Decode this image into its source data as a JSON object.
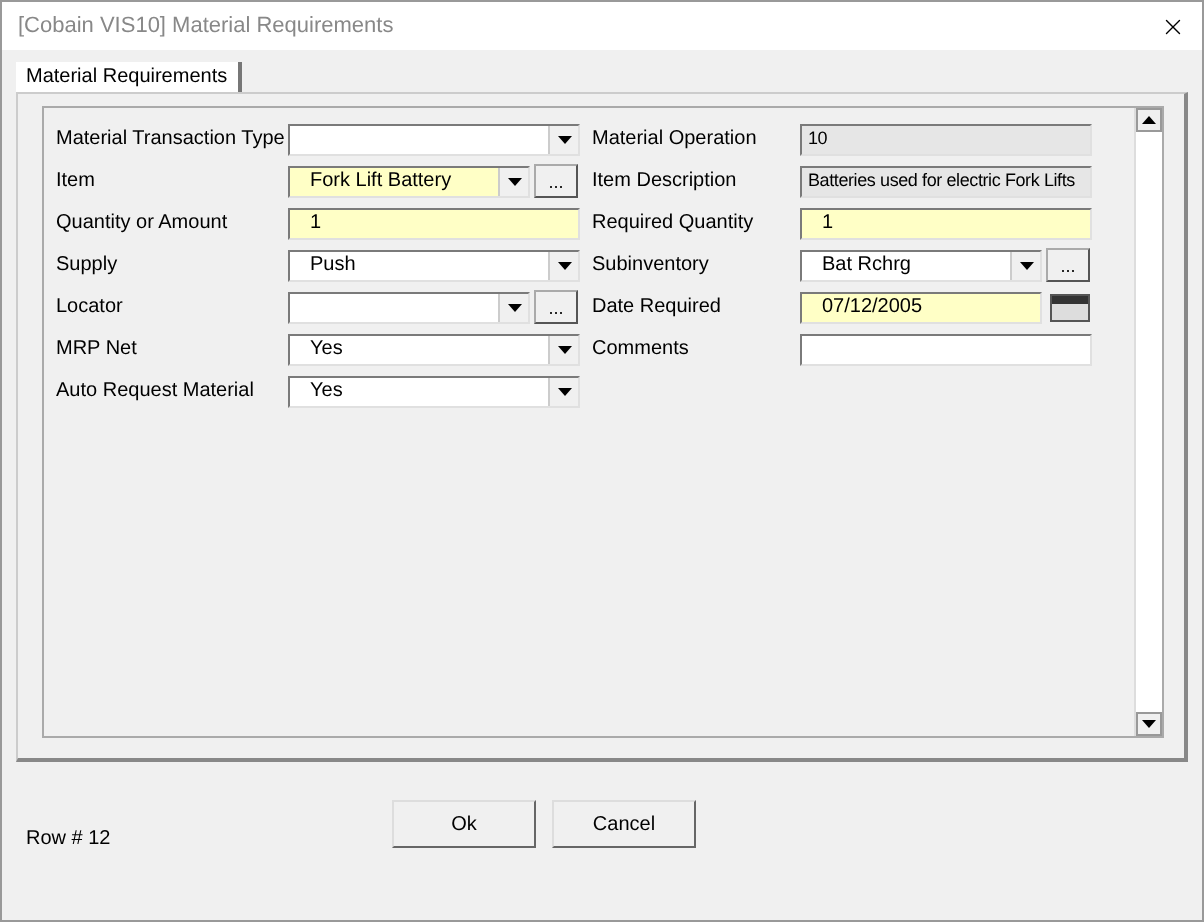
{
  "window": {
    "title": "[Cobain VIS10] Material Requirements"
  },
  "tabs": [
    {
      "label": "Material Requirements",
      "selected": true
    }
  ],
  "left_fields": [
    {
      "label": "Material Transaction Type",
      "kind": "dropdown",
      "required": false
    },
    {
      "label": "Item",
      "kind": "dropdown",
      "value": "Fork Lift Battery",
      "required": true,
      "lookup_button": "..."
    },
    {
      "label": "Quantity or Amount",
      "kind": "text",
      "value": "1",
      "required": true
    },
    {
      "label": "Supply",
      "kind": "dropdown",
      "value": "Push",
      "required": false
    },
    {
      "label": "Locator",
      "kind": "dropdown",
      "required": false,
      "lookup_button": "..."
    },
    {
      "label": "MRP Net",
      "kind": "dropdown",
      "value": "Yes",
      "required": false
    },
    {
      "label": "Auto Request Material",
      "kind": "dropdown",
      "value": "Yes",
      "required": false
    }
  ],
  "right_fields": [
    {
      "label": "Material Operation",
      "kind": "readonly",
      "value": "10"
    },
    {
      "label": "Item Description",
      "kind": "readonly",
      "value": "Batteries used for electric Fork Lifts"
    },
    {
      "label": "Required Quantity",
      "kind": "text",
      "value": "1",
      "required": true
    },
    {
      "label": "Subinventory",
      "kind": "dropdown",
      "value": "Bat Rchrg",
      "required": false,
      "lookup_button": "..."
    },
    {
      "label": "Date Required",
      "kind": "date",
      "value": "07/12/2005",
      "required": true
    },
    {
      "label": "Comments",
      "kind": "text",
      "required": false
    }
  ],
  "status": "Row # 12",
  "buttons": [
    "Ok",
    "Cancel"
  ]
}
